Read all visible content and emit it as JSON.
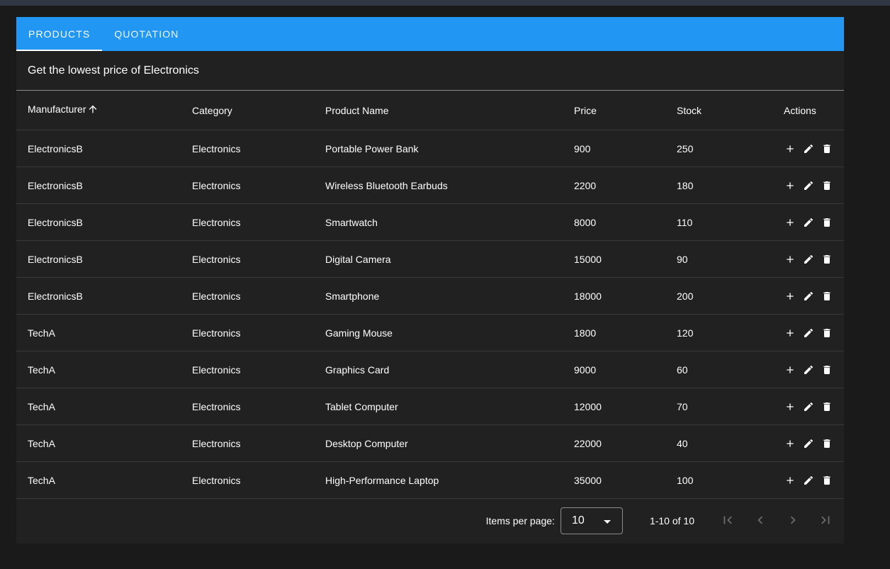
{
  "tabs": [
    {
      "label": "Products",
      "active": true
    },
    {
      "label": "Quotation",
      "active": false
    }
  ],
  "subtitle": "Get the lowest price of Electronics",
  "table": {
    "columns": [
      "Manufacturer",
      "Category",
      "Product Name",
      "Price",
      "Stock",
      "Actions"
    ],
    "sort": {
      "column": "Manufacturer",
      "direction": "ascending",
      "icon": "arrow-up-icon"
    },
    "rows": [
      {
        "manufacturer": "ElectronicsB",
        "category": "Electronics",
        "product": "Portable Power Bank",
        "price": "900",
        "stock": "250"
      },
      {
        "manufacturer": "ElectronicsB",
        "category": "Electronics",
        "product": "Wireless Bluetooth Earbuds",
        "price": "2200",
        "stock": "180"
      },
      {
        "manufacturer": "ElectronicsB",
        "category": "Electronics",
        "product": "Smartwatch",
        "price": "8000",
        "stock": "110"
      },
      {
        "manufacturer": "ElectronicsB",
        "category": "Electronics",
        "product": "Digital Camera",
        "price": "15000",
        "stock": "90"
      },
      {
        "manufacturer": "ElectronicsB",
        "category": "Electronics",
        "product": "Smartphone",
        "price": "18000",
        "stock": "200"
      },
      {
        "manufacturer": "TechA",
        "category": "Electronics",
        "product": "Gaming Mouse",
        "price": "1800",
        "stock": "120"
      },
      {
        "manufacturer": "TechA",
        "category": "Electronics",
        "product": "Graphics Card",
        "price": "9000",
        "stock": "60"
      },
      {
        "manufacturer": "TechA",
        "category": "Electronics",
        "product": "Tablet Computer",
        "price": "12000",
        "stock": "70"
      },
      {
        "manufacturer": "TechA",
        "category": "Electronics",
        "product": "Desktop Computer",
        "price": "22000",
        "stock": "40"
      },
      {
        "manufacturer": "TechA",
        "category": "Electronics",
        "product": "High-Performance Laptop",
        "price": "35000",
        "stock": "100"
      }
    ],
    "row_action_icons": [
      "add-icon",
      "edit-icon",
      "delete-icon"
    ]
  },
  "paginator": {
    "items_per_page_label": "Items per page:",
    "items_per_page_value": "10",
    "range_label": "1-10 of 10",
    "nav_icons": [
      "first-page-icon",
      "previous-page-icon",
      "next-page-icon",
      "last-page-icon"
    ]
  },
  "colors": {
    "tab_bar": "#2196f3",
    "card_background": "#212121",
    "page_background": "#1a1a1a",
    "top_bar": "#323843",
    "disabled_icon": "#6b6b6b"
  }
}
